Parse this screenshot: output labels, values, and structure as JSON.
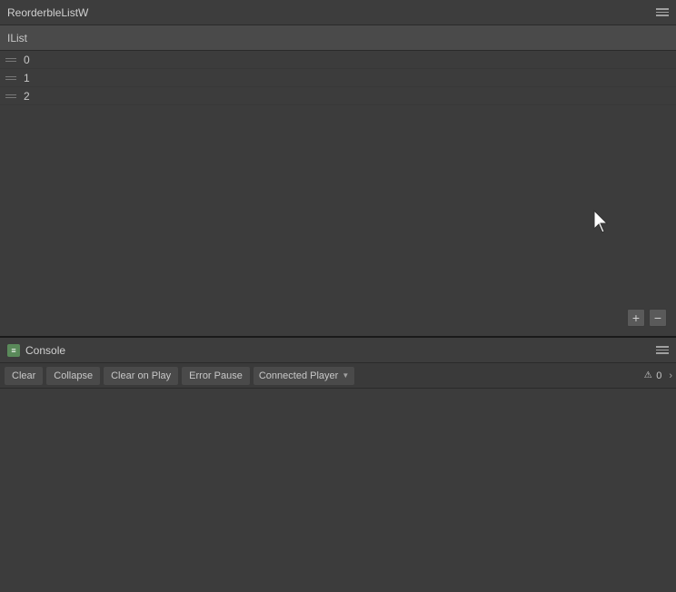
{
  "top_panel": {
    "title": "ReorderbleListW",
    "menu_label": "menu",
    "ilist_header": "IList",
    "items": [
      {
        "index": "0"
      },
      {
        "index": "1"
      },
      {
        "index": "2"
      }
    ],
    "add_button": "+",
    "remove_button": "−"
  },
  "bottom_panel": {
    "console_icon": "≡",
    "title": "Console",
    "toolbar": {
      "clear_label": "Clear",
      "collapse_label": "Collapse",
      "clear_on_play_label": "Clear on Play",
      "error_pause_label": "Error Pause",
      "connected_player_label": "Connected Player"
    },
    "counters": {
      "warning_icon": "⚠",
      "warning_count": "0",
      "overflow_label": "›"
    }
  }
}
